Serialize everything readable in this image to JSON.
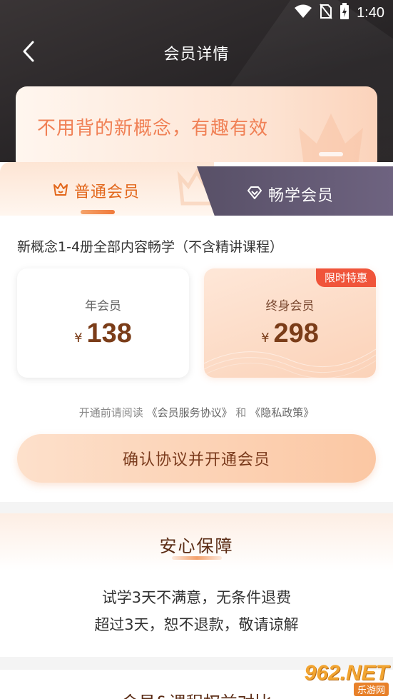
{
  "status_bar": {
    "time": "1:40"
  },
  "nav": {
    "title": "会员详情"
  },
  "banner": {
    "text": "不用背的新概念，有趣有效"
  },
  "tabs": [
    {
      "label": "普通会员",
      "active": true
    },
    {
      "label": "畅学会员",
      "active": false
    }
  ],
  "section": {
    "description": "新概念1-4册全部内容畅学（不含精讲课程）"
  },
  "plans": [
    {
      "name": "年会员",
      "currency": "¥",
      "price": "138",
      "badge": ""
    },
    {
      "name": "终身会员",
      "currency": "¥",
      "price": "298",
      "badge": "限时特惠"
    }
  ],
  "agreement": {
    "prefix": "开通前请阅读",
    "service_link": "《会员服务协议》",
    "and": "和",
    "privacy_link": "《隐私政策》"
  },
  "confirm_button": {
    "label": "确认协议并开通会员"
  },
  "guarantee": {
    "title": "安心保障",
    "line1": "试学3天不满意，无条件退费",
    "line2": "超过3天，恕不退款，敬请谅解"
  },
  "compare": {
    "title": "会员&课程权益对比"
  },
  "watermark": {
    "top": "962.NET",
    "bottom": "乐游网"
  },
  "colors": {
    "accent_orange": "#e2671b",
    "price_brown": "#7b3d19",
    "badge_red": "#f0543a",
    "smooth_tab": "#5e5570"
  }
}
